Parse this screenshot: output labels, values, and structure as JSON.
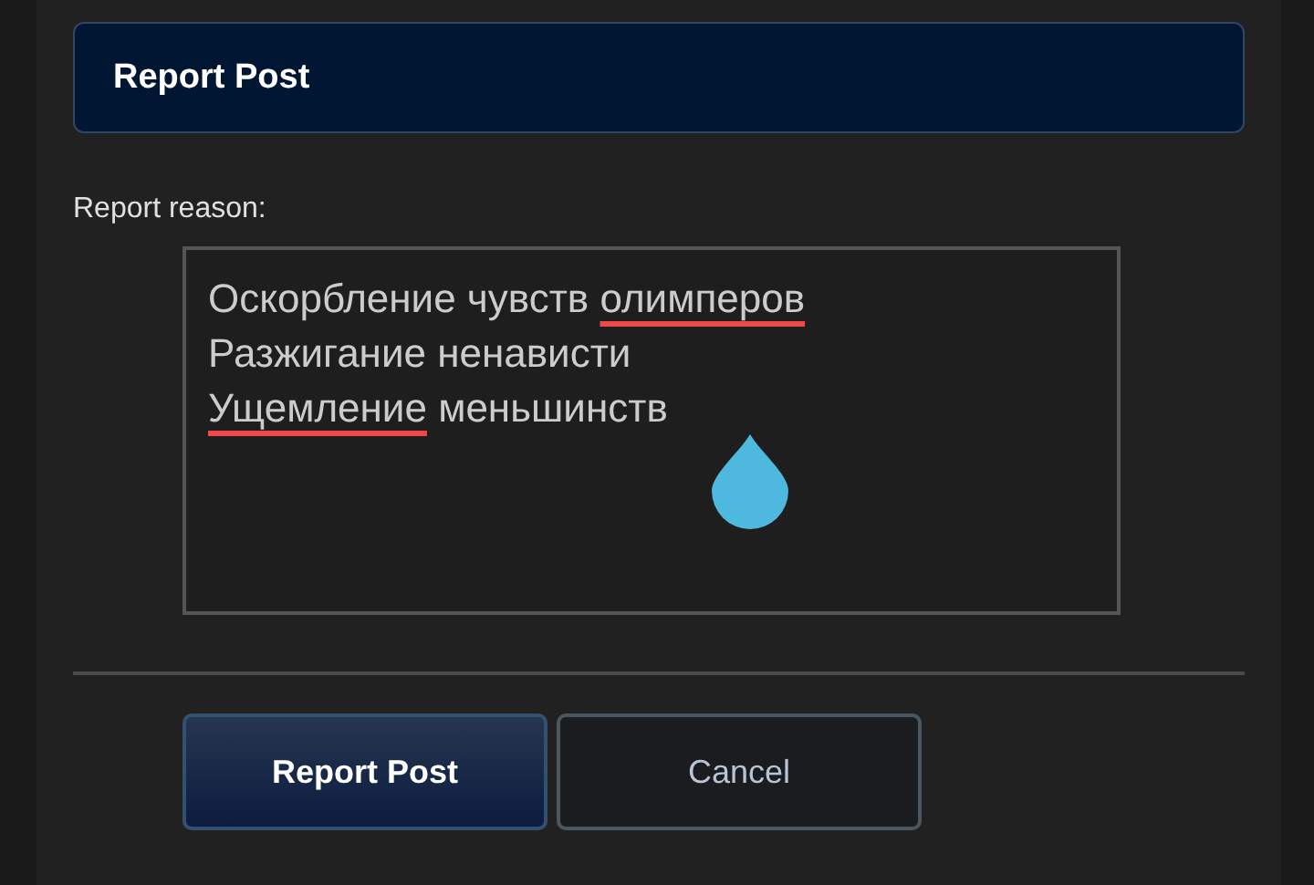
{
  "dialog": {
    "title": "Report Post"
  },
  "reason": {
    "label": "Report reason:",
    "lines": [
      [
        {
          "text": "Оскорбление чувств ",
          "misspelled": false
        },
        {
          "text": "олимперов",
          "misspelled": true
        }
      ],
      [
        {
          "text": "Разжигание ненависти",
          "misspelled": false
        }
      ],
      [
        {
          "text": "Ущемление",
          "misspelled": true
        },
        {
          "text": " меньшинств",
          "misspelled": false
        }
      ]
    ]
  },
  "buttons": [
    {
      "label": "Report Post",
      "kind": "primary"
    },
    {
      "label": "Cancel",
      "kind": "secondary"
    }
  ]
}
